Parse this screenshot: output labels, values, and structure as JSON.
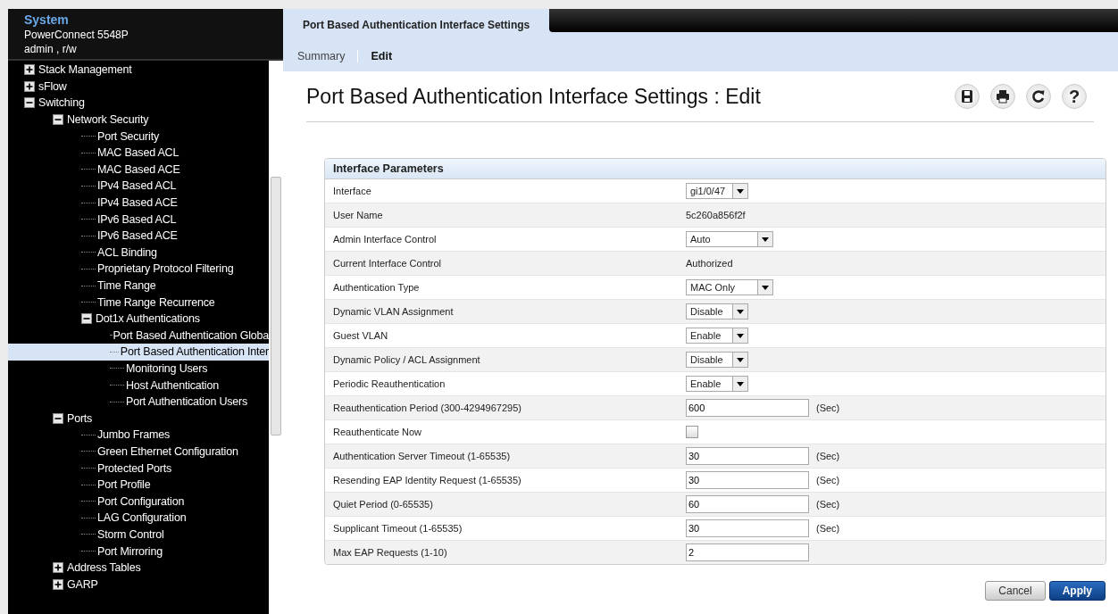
{
  "system": {
    "title": "System",
    "device": "PowerConnect 5548P",
    "user": "admin , r/w"
  },
  "tree": [
    {
      "label": "Stack Management",
      "expanded": false,
      "selected": false
    },
    {
      "label": "sFlow",
      "expanded": false,
      "selected": false
    },
    {
      "label": "Switching",
      "expanded": true,
      "selected": false,
      "children": [
        {
          "label": "Network Security",
          "expanded": true,
          "selected": false,
          "children": [
            {
              "label": "Port Security",
              "selected": false
            },
            {
              "label": "MAC Based ACL",
              "selected": false
            },
            {
              "label": "MAC Based ACE",
              "selected": false
            },
            {
              "label": "IPv4 Based ACL",
              "selected": false
            },
            {
              "label": "IPv4 Based ACE",
              "selected": false
            },
            {
              "label": "IPv6 Based ACL",
              "selected": false
            },
            {
              "label": "IPv6 Based ACE",
              "selected": false
            },
            {
              "label": "ACL Binding",
              "selected": false
            },
            {
              "label": "Proprietary Protocol Filtering",
              "selected": false
            },
            {
              "label": "Time Range",
              "selected": false
            },
            {
              "label": "Time Range Recurrence",
              "selected": false
            },
            {
              "label": "Dot1x Authentications",
              "expanded": true,
              "selected": false,
              "children": [
                {
                  "label": "Port Based Authentication Globa",
                  "selected": false
                },
                {
                  "label": "Port Based Authentication Inter",
                  "selected": true
                },
                {
                  "label": "Monitoring Users",
                  "selected": false
                },
                {
                  "label": "Host Authentication",
                  "selected": false
                },
                {
                  "label": "Port Authentication Users",
                  "selected": false
                }
              ]
            }
          ]
        },
        {
          "label": "Ports",
          "expanded": true,
          "selected": false,
          "children": [
            {
              "label": "Jumbo Frames",
              "selected": false
            },
            {
              "label": "Green Ethernet Configuration",
              "selected": false
            },
            {
              "label": "Protected Ports",
              "selected": false
            },
            {
              "label": "Port Profile",
              "selected": false
            },
            {
              "label": "Port Configuration",
              "selected": false
            },
            {
              "label": "LAG Configuration",
              "selected": false
            },
            {
              "label": "Storm Control",
              "selected": false
            },
            {
              "label": "Port Mirroring",
              "selected": false
            }
          ]
        },
        {
          "label": "Address Tables",
          "expanded": false,
          "selected": false
        },
        {
          "label": "GARP",
          "expanded": false,
          "selected": false
        }
      ]
    }
  ],
  "tabs": [
    {
      "label": "Port Based Authentication Interface Settings",
      "selected": true
    }
  ],
  "subnav": [
    {
      "label": "Summary",
      "selected": false
    },
    {
      "label": "Edit",
      "selected": true
    }
  ],
  "page_title": "Port Based Authentication Interface Settings : Edit",
  "help_label": "?",
  "panel": {
    "title": "Interface Parameters",
    "rows": [
      {
        "label": "Interface",
        "kind": "select",
        "value": "gi1/0/47"
      },
      {
        "label": "User Name",
        "kind": "text",
        "value": "5c260a856f2f"
      },
      {
        "label": "Admin Interface Control",
        "kind": "wide-select",
        "value": "Auto"
      },
      {
        "label": "Current Interface Control",
        "kind": "text",
        "value": "Authorized"
      },
      {
        "label": "Authentication Type",
        "kind": "wide-select",
        "value": "MAC Only"
      },
      {
        "label": "Dynamic VLAN Assignment",
        "kind": "select",
        "value": "Disable"
      },
      {
        "label": "Guest VLAN",
        "kind": "select",
        "value": "Enable"
      },
      {
        "label": "Dynamic Policy / ACL Assignment",
        "kind": "select",
        "value": "Disable"
      },
      {
        "label": "Periodic Reauthentication",
        "kind": "select",
        "value": "Enable"
      },
      {
        "label": "Reauthentication Period (300-4294967295)",
        "kind": "input",
        "value": "600",
        "unit": "(Sec)"
      },
      {
        "label": "Reauthenticate Now",
        "kind": "checkbox",
        "checked": false
      },
      {
        "label": "Authentication Server Timeout (1-65535)",
        "kind": "input",
        "value": "30",
        "unit": "(Sec)"
      },
      {
        "label": "Resending EAP Identity Request (1-65535)",
        "kind": "input",
        "value": "30",
        "unit": "(Sec)"
      },
      {
        "label": "Quiet Period (0-65535)",
        "kind": "input",
        "value": "60",
        "unit": "(Sec)"
      },
      {
        "label": "Supplicant Timeout (1-65535)",
        "kind": "input",
        "value": "30",
        "unit": "(Sec)"
      },
      {
        "label": "Max EAP Requests (1-10)",
        "kind": "input",
        "value": "2"
      }
    ]
  },
  "buttons": [
    {
      "label": "Cancel",
      "kind": "secondary"
    },
    {
      "label": "Apply",
      "kind": "primary"
    }
  ]
}
